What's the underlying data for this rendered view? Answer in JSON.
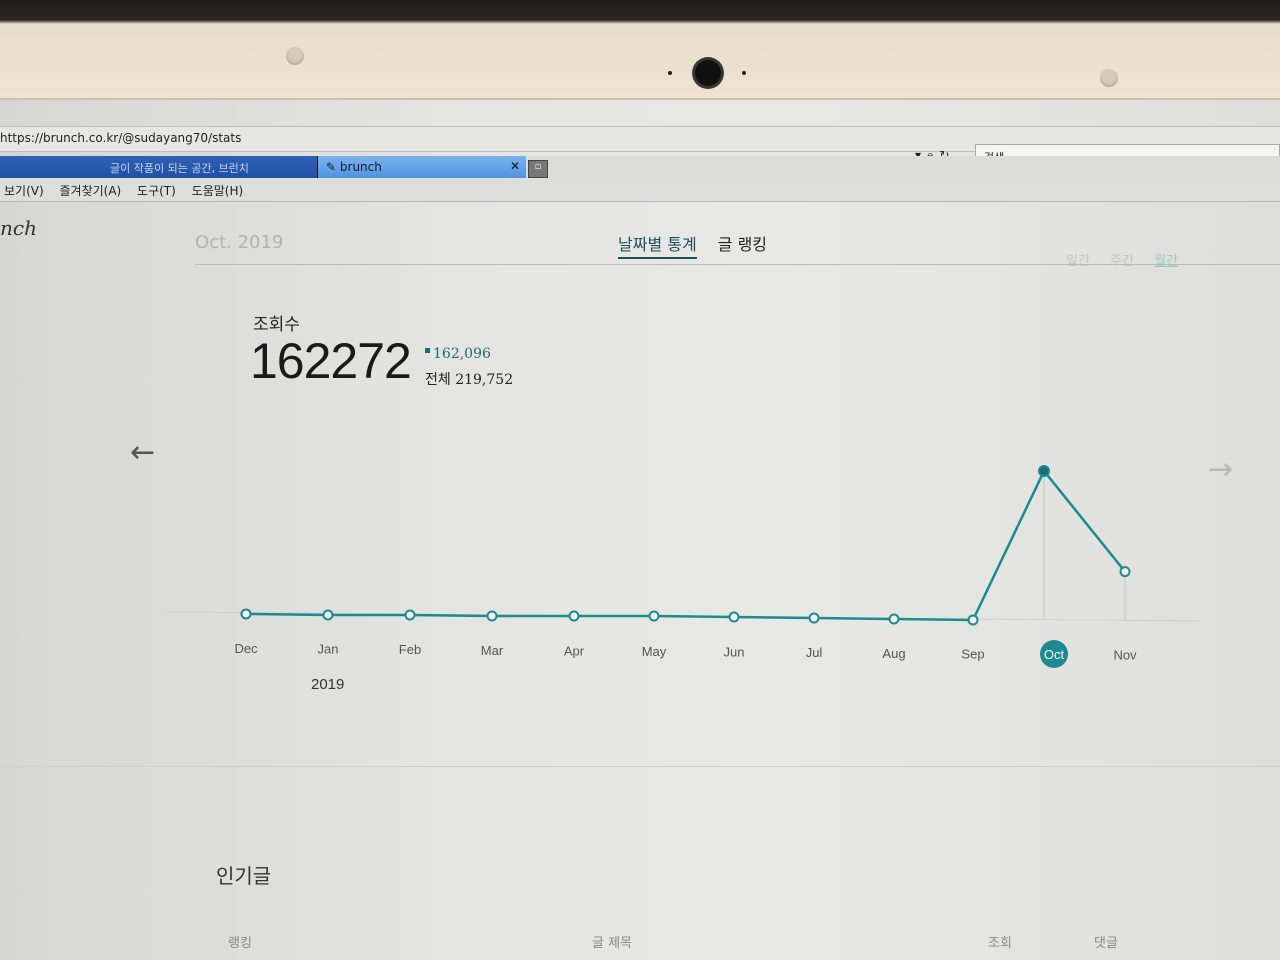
{
  "browser": {
    "url": "https://brunch.co.kr/@sudayang70/stats",
    "search_placeholder": "검색...",
    "tabs": [
      {
        "label": "글이 작품이 되는 공간, 브런치",
        "active": false
      },
      {
        "label": "brunch",
        "active": true
      }
    ],
    "menu": [
      "보기(V)",
      "즐겨찾기(A)",
      "도구(T)",
      "도움말(H)"
    ]
  },
  "page": {
    "brand": "nch",
    "month": "Oct. 2019",
    "nav_tabs": [
      "날짜별 통계",
      "글 랭킹"
    ],
    "period_options": [
      "일간",
      "주간",
      "월간"
    ],
    "selected_period": "월간",
    "views_label": "조회수",
    "views_value": "162272",
    "delta": "162,096",
    "total": "전체 219,752",
    "year_label": "2019",
    "popular_title": "인기글",
    "columns": [
      "랭킹",
      "글 제목",
      "조회",
      "댓글"
    ]
  },
  "colors": {
    "accent": "#1c8a91",
    "accent_dark": "#1c6e73"
  },
  "chart_data": {
    "type": "line",
    "categories": [
      "Dec",
      "Jan",
      "Feb",
      "Mar",
      "Apr",
      "May",
      "Jun",
      "Jul",
      "Aug",
      "Sep",
      "Oct",
      "Nov"
    ],
    "values": [
      60,
      6,
      3,
      3,
      2,
      3,
      2,
      3,
      2,
      1,
      162272,
      53800
    ],
    "selected": "Oct",
    "grid": false
  }
}
